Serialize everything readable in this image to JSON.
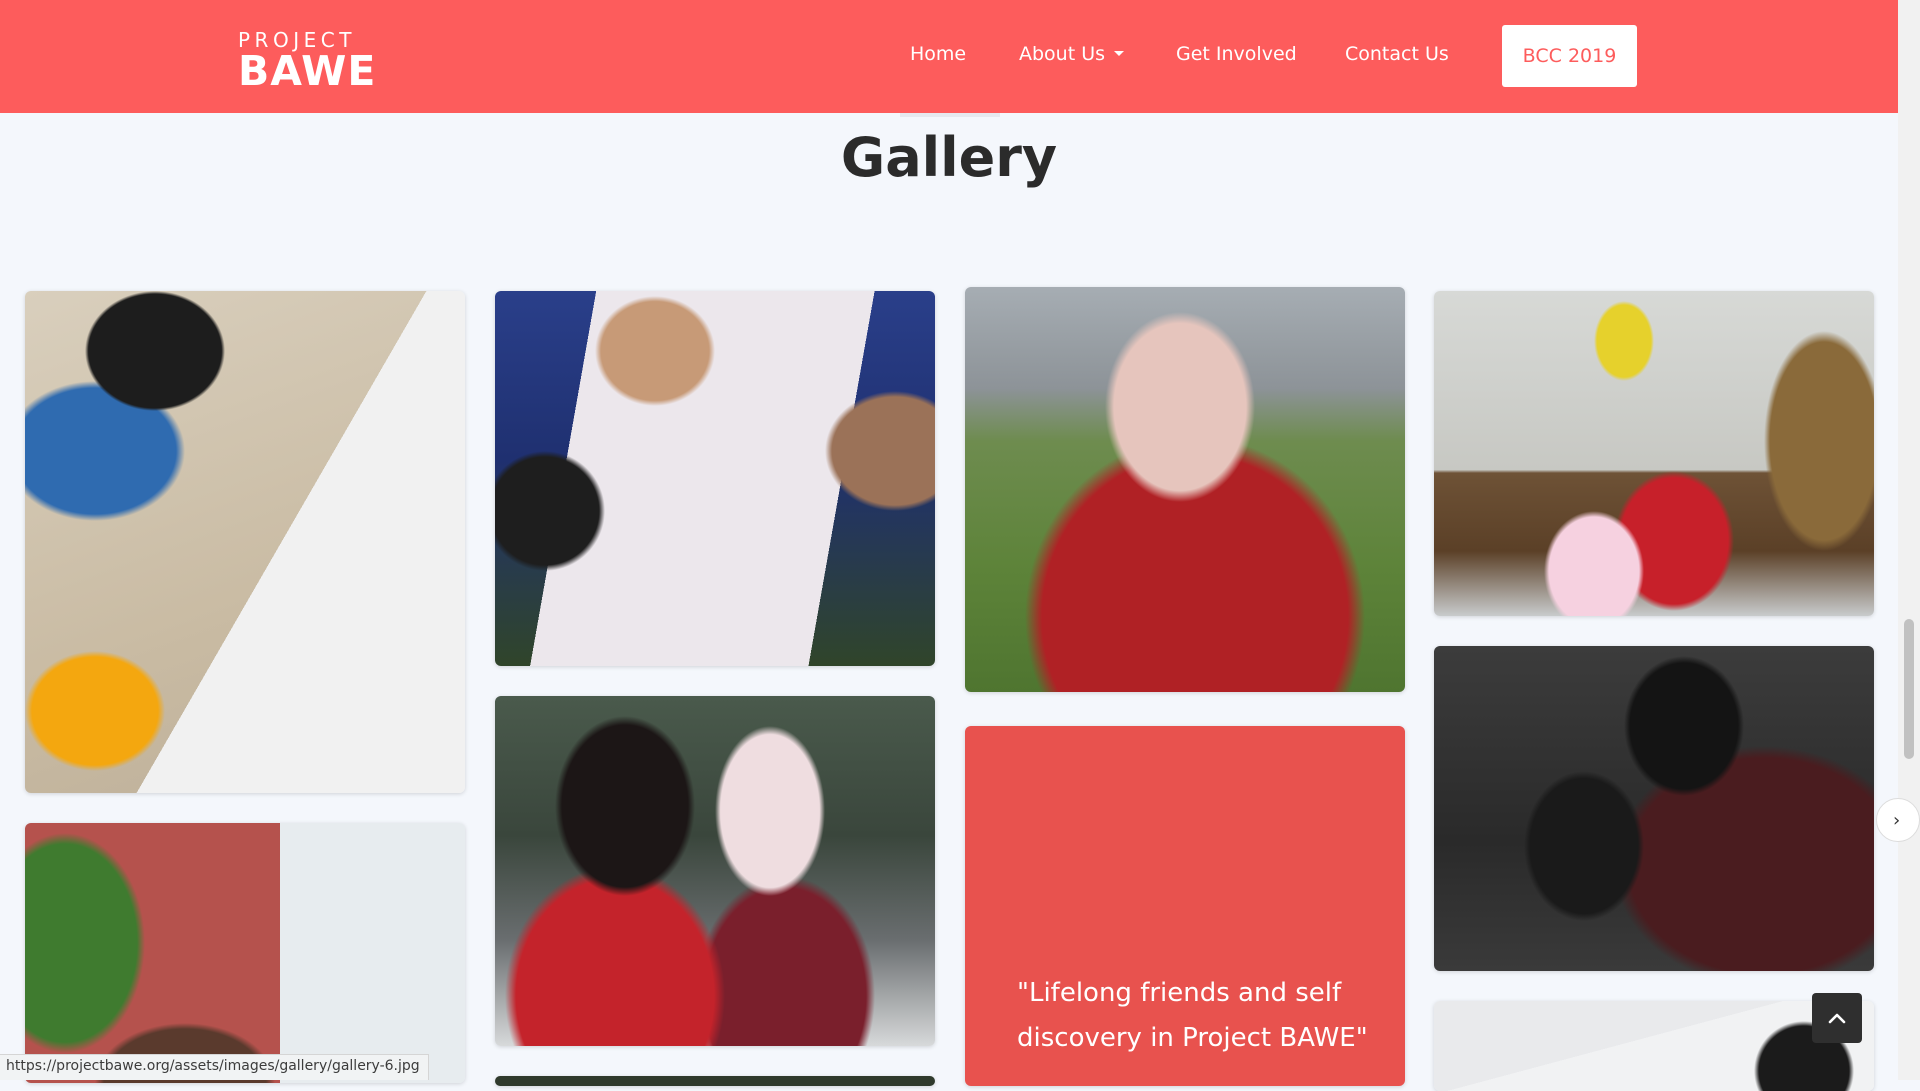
{
  "brand": {
    "top": "PROJECT",
    "main": "BAWE"
  },
  "nav": {
    "home": "Home",
    "about": "About Us",
    "get_involved": "Get Involved",
    "contact": "Contact Us",
    "cta": "BCC 2019"
  },
  "colors": {
    "brand_red": "#fd5c5c",
    "quote_red": "#e8524e",
    "background": "#f4f7fc"
  },
  "gallery": {
    "title": "Gallery",
    "quote": "\"Lifelong friends and self discovery in Project BAWE\""
  },
  "icons": {
    "next": "chevron-right-icon",
    "back_to_top": "chevron-up-icon"
  },
  "status_bar": {
    "url": "https://projectbawe.org/assets/images/gallery/gallery-6.jpg"
  }
}
